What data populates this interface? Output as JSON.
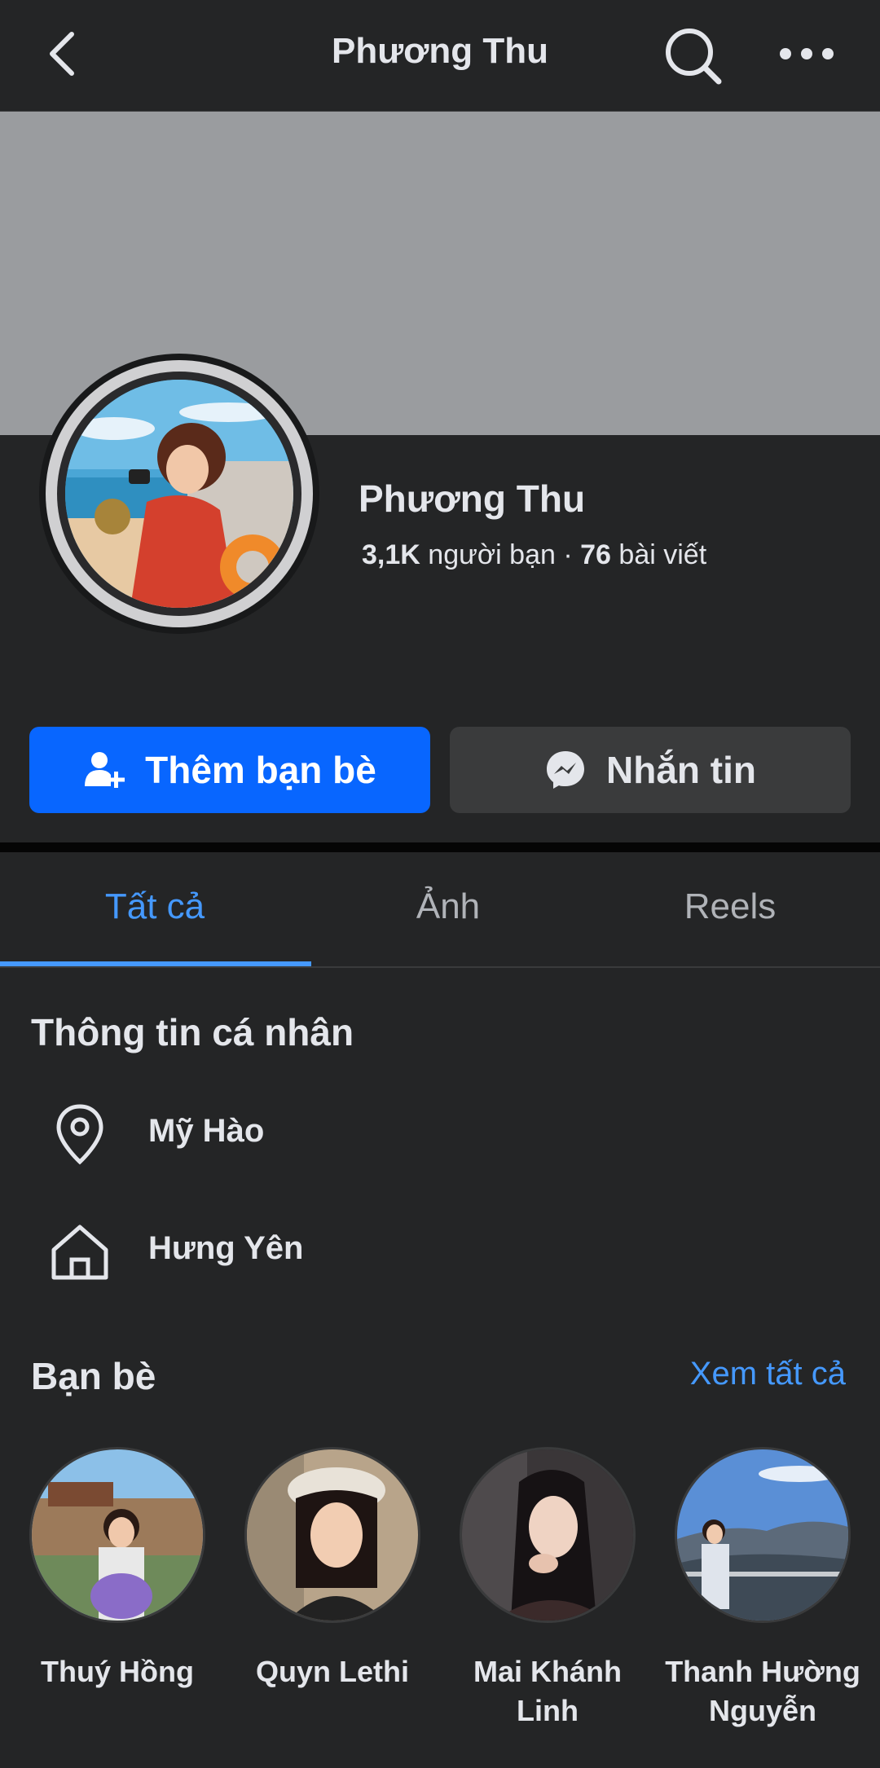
{
  "header": {
    "title": "Phương Thu"
  },
  "profile": {
    "name": "Phương Thu",
    "friends_count": "3,1K",
    "friends_label": "người bạn",
    "separator": "·",
    "posts_count": "76",
    "posts_label": "bài viết"
  },
  "actions": {
    "add_friend_label": "Thêm bạn bè",
    "message_label": "Nhắn tin"
  },
  "tabs": [
    {
      "label": "Tất cả",
      "active": true
    },
    {
      "label": "Ảnh",
      "active": false
    },
    {
      "label": "Reels",
      "active": false
    }
  ],
  "personal_info": {
    "title": "Thông tin cá nhân",
    "items": [
      {
        "icon": "location-pin-icon",
        "text": "Mỹ Hào"
      },
      {
        "icon": "home-icon",
        "text": "Hưng Yên"
      }
    ]
  },
  "friends": {
    "title": "Bạn bè",
    "see_all_label": "Xem tất cả",
    "items": [
      {
        "name": "Thuý Hồng"
      },
      {
        "name": "Quyn Lethi"
      },
      {
        "name": "Mai Khánh Linh"
      },
      {
        "name": "Thanh Hường Nguyễn"
      }
    ]
  },
  "colors": {
    "accent": "#4599ff",
    "primary_button": "#0866ff",
    "background": "#242526"
  }
}
